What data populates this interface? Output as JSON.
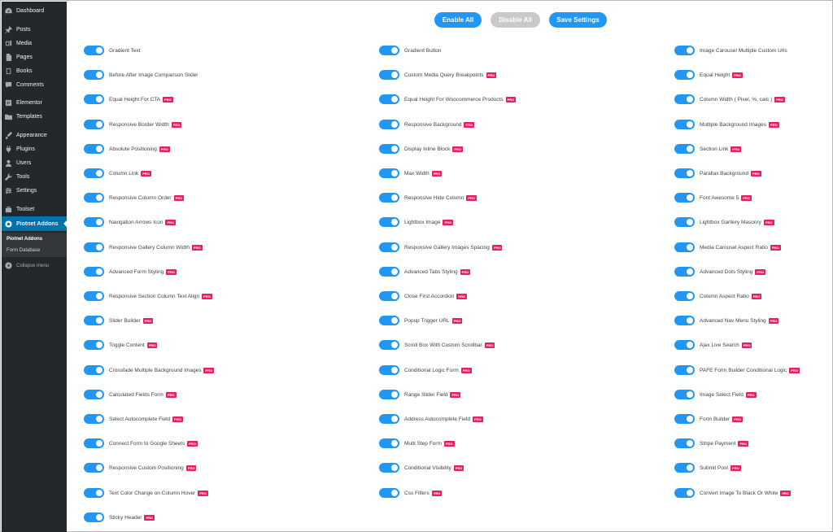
{
  "sidebar": {
    "items": [
      {
        "key": "dashboard",
        "label": "Dashboard",
        "icon": "gauge-icon"
      },
      {
        "key": "posts",
        "label": "Posts",
        "icon": "pin-icon"
      },
      {
        "key": "media",
        "label": "Media",
        "icon": "media-icon"
      },
      {
        "key": "pages",
        "label": "Pages",
        "icon": "page-icon"
      },
      {
        "key": "books",
        "label": "Books",
        "icon": "book-icon"
      },
      {
        "key": "comments",
        "label": "Comments",
        "icon": "comment-icon"
      },
      {
        "key": "elementor",
        "label": "Elementor",
        "icon": "elementor-icon"
      },
      {
        "key": "templates",
        "label": "Templates",
        "icon": "folder-icon"
      },
      {
        "key": "appearance",
        "label": "Appearance",
        "icon": "brush-icon"
      },
      {
        "key": "plugins",
        "label": "Plugins",
        "icon": "plug-icon"
      },
      {
        "key": "users",
        "label": "Users",
        "icon": "user-icon"
      },
      {
        "key": "tools",
        "label": "Tools",
        "icon": "wrench-icon"
      },
      {
        "key": "settings",
        "label": "Settings",
        "icon": "sliders-icon"
      },
      {
        "key": "toolset",
        "label": "Toolset",
        "icon": "toolset-icon"
      },
      {
        "key": "piotnet",
        "label": "Piotnet Addons",
        "icon": "piotnet-icon"
      }
    ],
    "submenu": [
      "Piotnet Addons",
      "Form Database"
    ],
    "collapse_label": "Collapse menu"
  },
  "toolbar": {
    "enable_all": "Enable All",
    "disable_all": "Disable All",
    "save_settings": "Save Settings"
  },
  "pro_label": "PRO",
  "features": [
    [
      {
        "label": "Gradient Text",
        "pro": false,
        "enabled": true
      },
      {
        "label": "Before After Image Comparison Slider",
        "pro": false,
        "enabled": true
      },
      {
        "label": "Equal Height For CTA",
        "pro": true,
        "enabled": true
      },
      {
        "label": "Responsive Border Width",
        "pro": true,
        "enabled": true
      },
      {
        "label": "Absolute Positioning",
        "pro": true,
        "enabled": true
      },
      {
        "label": "Column Link",
        "pro": true,
        "enabled": true
      },
      {
        "label": "Responsive Column Order",
        "pro": true,
        "enabled": true
      },
      {
        "label": "Navigation Arrows Icon",
        "pro": true,
        "enabled": true
      },
      {
        "label": "Responsive Gallery Column Width",
        "pro": true,
        "enabled": true
      },
      {
        "label": "Advanced Form Styling",
        "pro": true,
        "enabled": true
      },
      {
        "label": "Responsive Section Column Text Align",
        "pro": true,
        "enabled": true
      },
      {
        "label": "Slider Builder",
        "pro": true,
        "enabled": true
      },
      {
        "label": "Toggle Content",
        "pro": true,
        "enabled": true
      },
      {
        "label": "Crossfade Multiple Background Images",
        "pro": true,
        "enabled": true
      },
      {
        "label": "Calculated Fields Form",
        "pro": true,
        "enabled": true
      },
      {
        "label": "Select Autocomplete Field",
        "pro": true,
        "enabled": true
      },
      {
        "label": "Connect Form to Google Sheets",
        "pro": true,
        "enabled": true
      },
      {
        "label": "Responsive Custom Positioning",
        "pro": true,
        "enabled": true
      },
      {
        "label": "Text Color Change on Column Hover",
        "pro": true,
        "enabled": true
      },
      {
        "label": "Sticky Header",
        "pro": true,
        "enabled": true
      }
    ],
    [
      {
        "label": "Gradient Button",
        "pro": false,
        "enabled": true
      },
      {
        "label": "Custom Media Query Breakpoints",
        "pro": true,
        "enabled": true
      },
      {
        "label": "Equal Height For Woocommerce Products",
        "pro": true,
        "enabled": true
      },
      {
        "label": "Responsive Background",
        "pro": true,
        "enabled": true
      },
      {
        "label": "Display Inline Block",
        "pro": true,
        "enabled": true
      },
      {
        "label": "Max Width",
        "pro": true,
        "enabled": true
      },
      {
        "label": "Responsive Hide Column",
        "pro": true,
        "enabled": true
      },
      {
        "label": "Lightbox Image",
        "pro": true,
        "enabled": true
      },
      {
        "label": "Responsive Gallery Images Spacing",
        "pro": true,
        "enabled": true
      },
      {
        "label": "Advanced Tabs Styling",
        "pro": true,
        "enabled": true
      },
      {
        "label": "Close First Accordion",
        "pro": true,
        "enabled": true
      },
      {
        "label": "Popup Trigger URL",
        "pro": true,
        "enabled": true
      },
      {
        "label": "Scroll Box With Custom Scrollbar",
        "pro": true,
        "enabled": true
      },
      {
        "label": "Conditional Logic Form",
        "pro": true,
        "enabled": true
      },
      {
        "label": "Range Slider Field",
        "pro": true,
        "enabled": true
      },
      {
        "label": "Address Autocomplete Field",
        "pro": true,
        "enabled": true
      },
      {
        "label": "Multi Step Form",
        "pro": true,
        "enabled": true
      },
      {
        "label": "Conditional Visibility",
        "pro": true,
        "enabled": true
      },
      {
        "label": "Css Filters",
        "pro": true,
        "enabled": true
      }
    ],
    [
      {
        "label": "Image Carousel Multiple Custom Urls",
        "pro": false,
        "enabled": true
      },
      {
        "label": "Equal Height",
        "pro": true,
        "enabled": true
      },
      {
        "label": "Column Width ( Pixel, %, calc )",
        "pro": true,
        "enabled": true
      },
      {
        "label": "Multiple Background Images",
        "pro": true,
        "enabled": true
      },
      {
        "label": "Section Link",
        "pro": true,
        "enabled": true
      },
      {
        "label": "Parallax Background",
        "pro": true,
        "enabled": true
      },
      {
        "label": "Font Awesome 5",
        "pro": true,
        "enabled": true
      },
      {
        "label": "Lightbox Garllery Masonry",
        "pro": true,
        "enabled": true
      },
      {
        "label": "Media Carousel Aspect Ratio",
        "pro": true,
        "enabled": true
      },
      {
        "label": "Advanced Dots Styling",
        "pro": true,
        "enabled": true
      },
      {
        "label": "Column Aspect Ratio",
        "pro": true,
        "enabled": true
      },
      {
        "label": "Advanced Nav Menu Styling",
        "pro": true,
        "enabled": true
      },
      {
        "label": "Ajax Live Search",
        "pro": true,
        "enabled": true
      },
      {
        "label": "PAFE Form Builder Conditional Logic",
        "pro": true,
        "enabled": true
      },
      {
        "label": "Image Select Field",
        "pro": true,
        "enabled": true
      },
      {
        "label": "Form Builder",
        "pro": true,
        "enabled": true
      },
      {
        "label": "Stripe Payment",
        "pro": true,
        "enabled": true
      },
      {
        "label": "Submit Post",
        "pro": true,
        "enabled": true
      },
      {
        "label": "Convert Image To Black Or White",
        "pro": true,
        "enabled": true
      }
    ]
  ],
  "colors": {
    "accent": "#2196f3",
    "pro_badge": "#e91e63",
    "sidebar_bg": "#23282d",
    "active_menu": "#0073aa",
    "disabled_button": "#c9c9c9"
  }
}
